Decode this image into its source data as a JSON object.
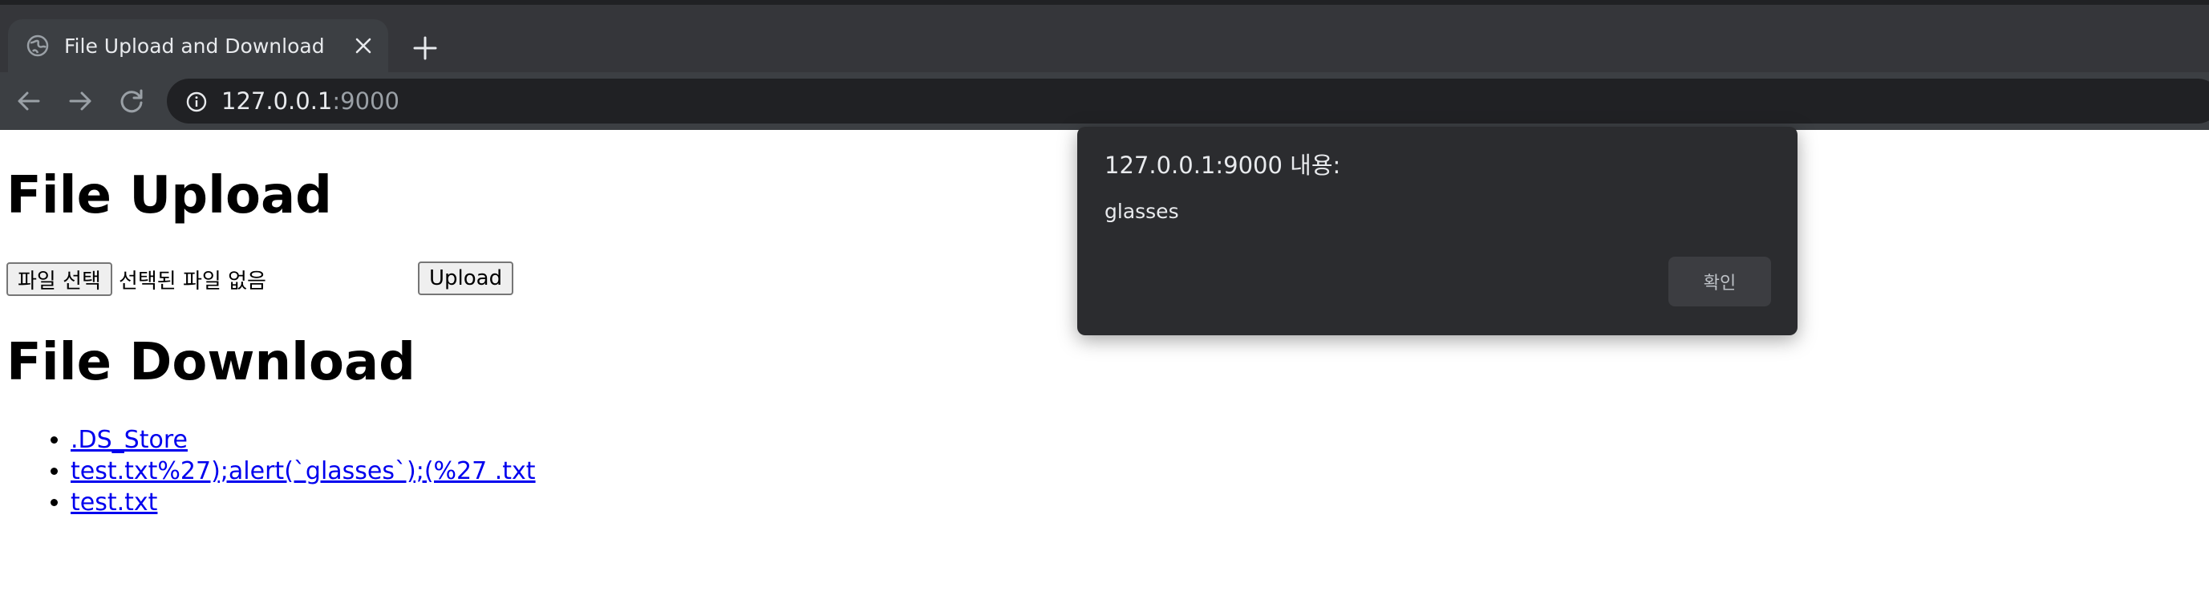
{
  "browser": {
    "tab": {
      "title": "File Upload and Download",
      "favicon": "globe-icon",
      "close_icon": "close-icon"
    },
    "new_tab_icon": "plus-icon",
    "nav": {
      "back_icon": "arrow-left-icon",
      "forward_icon": "arrow-right-icon",
      "reload_icon": "reload-icon"
    },
    "omnibox": {
      "info_icon": "info-icon",
      "host": "127.0.0.1",
      "port": ":9000"
    }
  },
  "page": {
    "upload": {
      "heading": "File Upload",
      "choose_file_label": "파일 선택",
      "no_file_text": "선택된 파일 없음",
      "upload_label": "Upload"
    },
    "download": {
      "heading": "File Download",
      "files": [
        ".DS_Store",
        "test.txt%27);alert(`glasses`);(%27 .txt",
        "test.txt"
      ]
    }
  },
  "dialog": {
    "title": "127.0.0.1:9000 내용:",
    "message": "glasses",
    "ok_label": "확인"
  },
  "colors": {
    "tabstrip": "#35363a",
    "toolbar": "#3c3f43",
    "omnibox": "#202124",
    "dialog_bg": "#2b2c2f",
    "link": "#0000ee"
  }
}
